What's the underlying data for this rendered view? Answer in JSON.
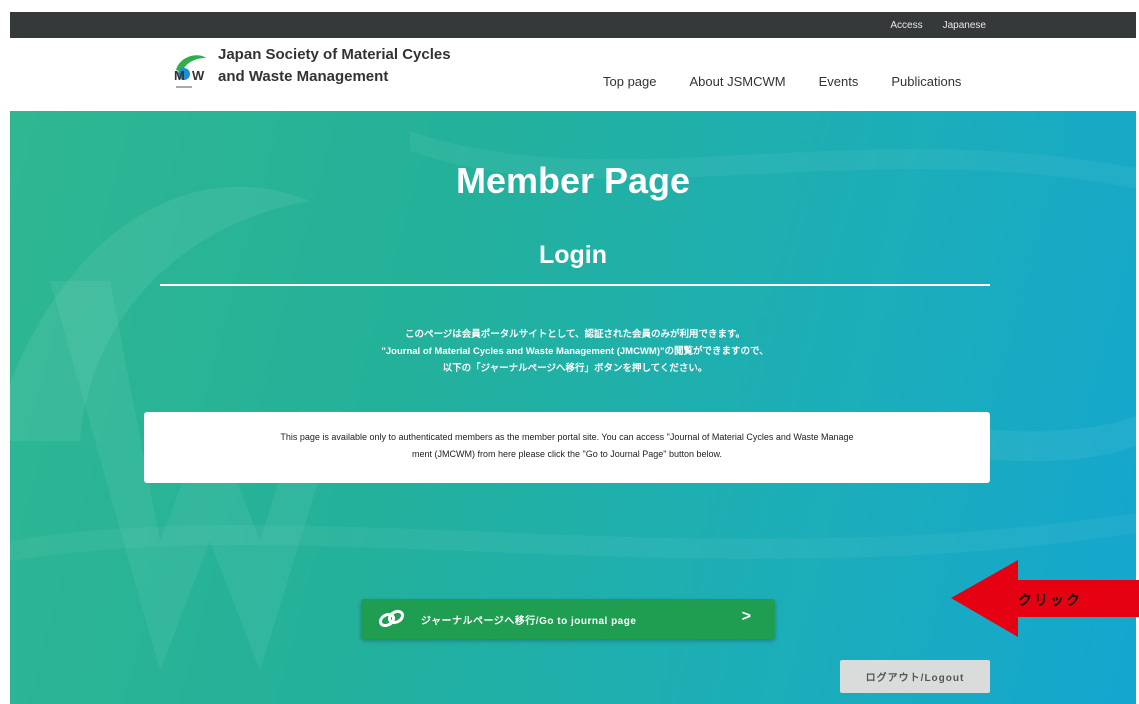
{
  "topbar": {
    "access": "Access",
    "japanese": "Japanese"
  },
  "header": {
    "org_line1": "Japan Society of Material Cycles",
    "org_line2": "and Waste Management",
    "nav": [
      "Top page",
      "About JSMCWM",
      "Events",
      "Publications"
    ]
  },
  "hero": {
    "title": "Member Page",
    "subtitle": "Login",
    "jp_lines": [
      "このページは会員ポータルサイトとして、認証された会員のみが利用できます。",
      "\"Journal of Material Cycles and Waste Management (JMCWM)\"の閲覧ができますので、",
      "以下の「ジャーナルページへ移行」ボタンを押してください。"
    ],
    "notice_line1": "This page is available only to authenticated members as the member portal site. You can access \"Journal of Material Cycles and Waste Manage",
    "notice_line2": "ment (JMCWM) from here   please click the \"Go to Journal Page\" button below.",
    "journal_button": "ジャーナルページへ移行/Go to journal page",
    "journal_chevron": ">",
    "logout_button": "ログアウト/Logout"
  },
  "annotation": {
    "label": "クリック",
    "color": "#e50012"
  },
  "colors": {
    "button_green": "#1f9e52",
    "topbar": "#36393a"
  }
}
